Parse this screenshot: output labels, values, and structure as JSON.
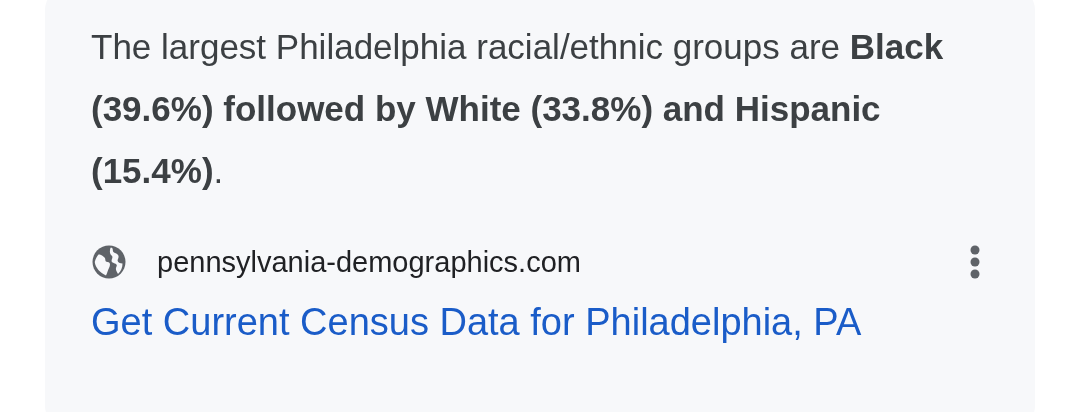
{
  "snippet": {
    "text": "The largest Philadelphia racial/ethnic groups are **Black (39.6%) followed by White (33.8%) and Hispanic (15.4%)**."
  },
  "source": {
    "domain": "pennsylvania-demographics.com"
  },
  "result": {
    "title": "Get Current Census Data for Philadelphia, PA"
  }
}
